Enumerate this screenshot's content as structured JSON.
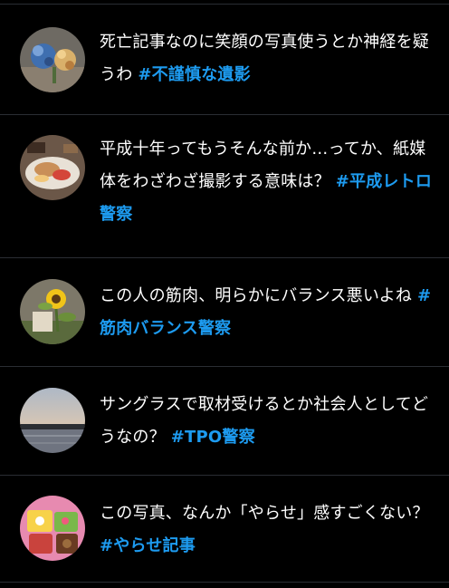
{
  "posts": [
    {
      "avatar": "flower-bouquet-photo",
      "text": "死亡記事なのに笑顔の写真使うとか神経を疑うわ ",
      "hashtag": "#不謹慎な遺影"
    },
    {
      "avatar": "food-platter-photo",
      "text": "平成十年ってもうそんな前か…ってか、紙媒体をわざわざ撮影する意味は？ ",
      "hashtag": "#平成レトロ警察"
    },
    {
      "avatar": "sunflower-photo",
      "text": "この人の筋肉、明らかにバランス悪いよね ",
      "hashtag": "#筋肉バランス警察"
    },
    {
      "avatar": "sunset-sea-photo",
      "text": "サングラスで取材受けるとか社会人としてどうなの？ ",
      "hashtag": "#TPO警察"
    },
    {
      "avatar": "bento-box-photo",
      "text": "この写真、なんか「やらせ」感すごくない？ ",
      "hashtag": "#やらせ記事"
    }
  ],
  "colors": {
    "background": "#000000",
    "text": "#ffffff",
    "hashtag": "#1d9bf0",
    "divider": "#2a2d33"
  }
}
